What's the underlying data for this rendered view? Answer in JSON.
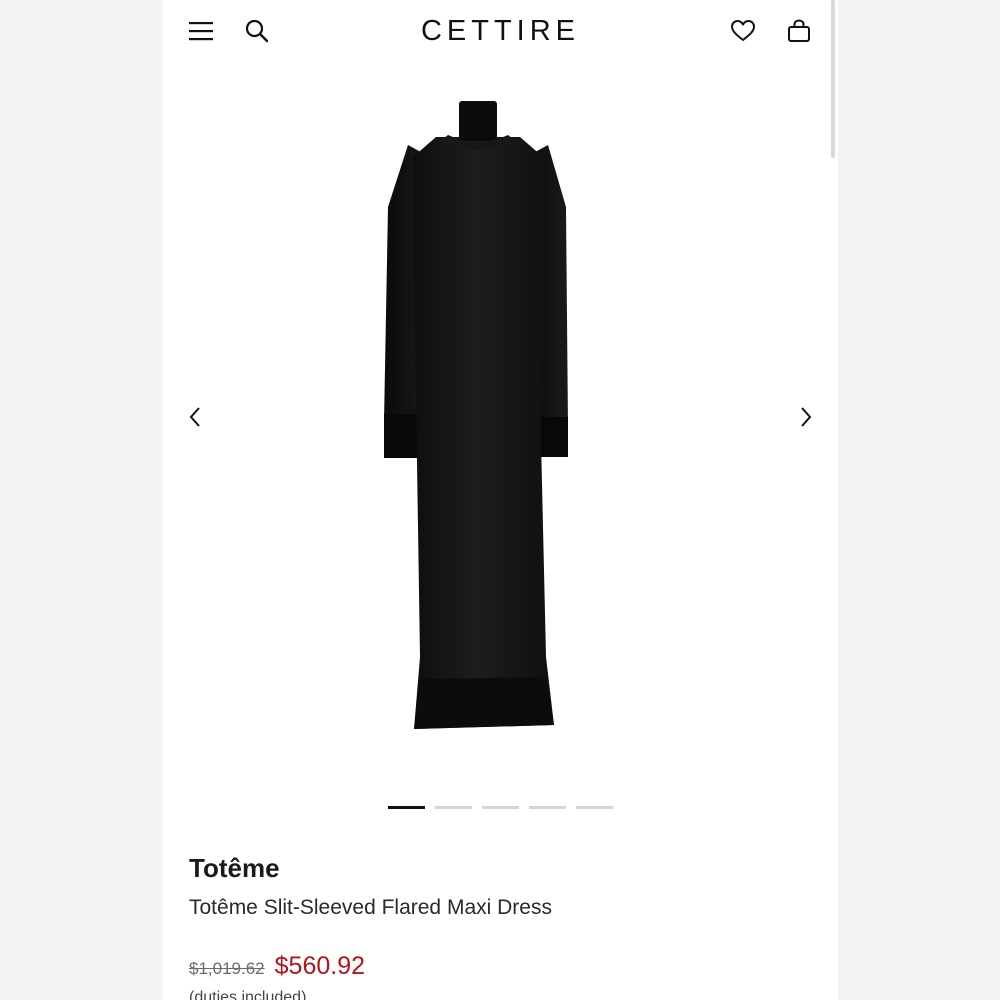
{
  "header": {
    "logo": "CETTIRE",
    "icons": {
      "menu": "menu-icon",
      "search": "search-icon",
      "wishlist": "heart-icon",
      "bag": "shopping-bag-icon"
    }
  },
  "gallery": {
    "image_count": 5,
    "active_index": 0,
    "prev_icon": "chevron-left-icon",
    "next_icon": "chevron-right-icon"
  },
  "product": {
    "brand": "Totême",
    "name": "Totême Slit-Sleeved Flared Maxi Dress",
    "original_price": "$1,019.62",
    "sale_price": "$560.92",
    "duties_note": "(duties included)"
  },
  "colors": {
    "sale": "#b3141b",
    "text": "#1a1a1a",
    "dress": "#141414"
  }
}
